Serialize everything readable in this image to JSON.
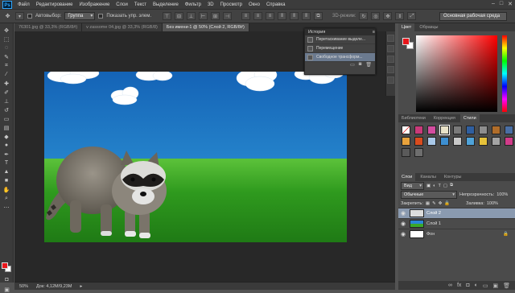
{
  "menubar": {
    "items": [
      "Файл",
      "Редактирование",
      "Изображение",
      "Слои",
      "Текст",
      "Выделение",
      "Фильтр",
      "3D",
      "Просмотр",
      "Окно",
      "Справка"
    ]
  },
  "options": {
    "autoselect_label": "Автовыбор:",
    "autoselect_value": "Группа",
    "show_controls_label": "Показать упр. элем.",
    "mode_3d": "3D-режим:",
    "workspace": "Основная рабочая среда"
  },
  "tabs": [
    {
      "label": "76301.jpg @ 33,3% (RGB/8#)",
      "active": false
    },
    {
      "label": "v zassome 04.jpg @ 33,3% (RGB/8)",
      "active": false
    },
    {
      "label": "Без имени-1 @ 50% (Слой 2, RGB/8#)",
      "active": true
    }
  ],
  "status": {
    "zoom": "50%",
    "doc": "Док: 4,12М/9,23М"
  },
  "history": {
    "title": "История",
    "items": [
      {
        "label": "Перетаскивание выделе...",
        "selected": false
      },
      {
        "label": "Перемещение",
        "selected": false
      },
      {
        "label": "Свободное трансформ...",
        "selected": true
      }
    ]
  },
  "color_panel": {
    "tabs": [
      "Цвет",
      "Образцы"
    ],
    "foreground": "#e8161b",
    "background": "#ffffff"
  },
  "styles_panel": {
    "tabs": [
      "Библиотеки",
      "Коррекция",
      "Стили"
    ]
  },
  "layers_panel": {
    "tabs": [
      "Слои",
      "Каналы",
      "Контуры"
    ],
    "kind_label": "Вид",
    "blend_mode": "Обычные",
    "opacity_label": "Непрозрачность:",
    "opacity_value": "100%",
    "lock_label": "Закрепить:",
    "fill_label": "Заливка:",
    "fill_value": "100%",
    "layers": [
      {
        "name": "Слой 2",
        "active": true
      },
      {
        "name": "Слой 1",
        "active": false
      },
      {
        "name": "Фон",
        "active": false
      }
    ]
  }
}
